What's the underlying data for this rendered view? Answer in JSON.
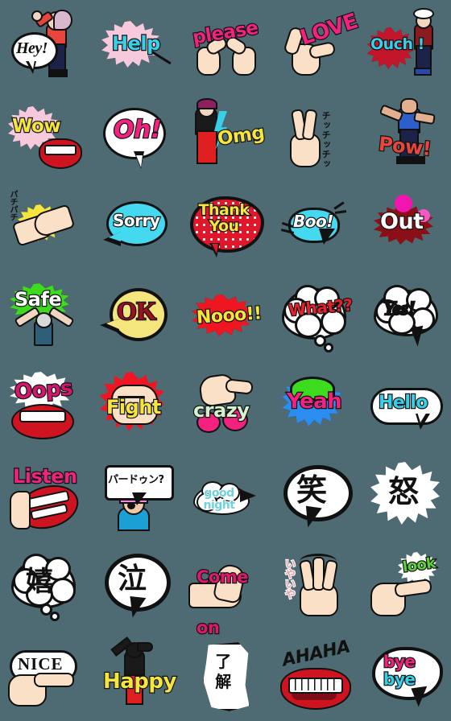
{
  "page": {
    "title": "Sticker Set Preview",
    "background_color": "#4e6b73",
    "columns": 5,
    "rows": 8,
    "cell_size_px": 112,
    "total_stickers": 40
  },
  "stickers": [
    {
      "id": 1,
      "text": "Hey!",
      "row": 1,
      "col": 1,
      "style": "speech-bubble-oval",
      "text_color": "#111111",
      "accent_color": "#e8453c",
      "art": "woman-waving-with-white-speech-bubble"
    },
    {
      "id": 2,
      "text": "Help",
      "row": 1,
      "col": 2,
      "style": "starburst",
      "text_color": "#38d0e8",
      "accent_color": "#f7c9dc",
      "art": "pink-starburst-with-pointer-line"
    },
    {
      "id": 3,
      "text": "please",
      "row": 1,
      "col": 3,
      "style": "hands-plain-text",
      "text_color": "#f3227f",
      "accent_color": "#fbe0c8",
      "art": "two-pointing-hands"
    },
    {
      "id": 4,
      "text": "LOVE",
      "row": 1,
      "col": 4,
      "style": "hand-plain-text",
      "text_color": "#f3227f",
      "accent_color": "#fbe0c8",
      "art": "finger-gun-hand-making-L"
    },
    {
      "id": 5,
      "text": "Ouch !",
      "row": 1,
      "col": 5,
      "style": "starburst",
      "text_color": "#38d0e8",
      "accent_color": "#c3162a",
      "art": "person-hit-with-red-burst"
    },
    {
      "id": 6,
      "text": "Wow",
      "row": 2,
      "col": 1,
      "style": "starburst",
      "text_color": "#f5e53c",
      "accent_color": "#f7c9dc",
      "art": "red-lips-with-pink-starburst"
    },
    {
      "id": 7,
      "text": "Oh!",
      "row": 2,
      "col": 2,
      "style": "speech-bubble-oval",
      "text_color": "#f3227f",
      "accent_color": "#ffffff",
      "art": "white-round-speech-bubble"
    },
    {
      "id": 8,
      "text": "Omg",
      "row": 2,
      "col": 3,
      "style": "lightning",
      "text_color": "#f5e53c",
      "accent_color": "#38d0e8",
      "art": "person-head-grab-with-lightning"
    },
    {
      "id": 9,
      "text": "チッチッチッ",
      "row": 2,
      "col": 4,
      "style": "hand-plain-text",
      "text_color": "#111111",
      "accent_color": "#fbe0c8",
      "art": "peace-sign-hand-with-kana"
    },
    {
      "id": 10,
      "text": "Pow!",
      "row": 2,
      "col": 5,
      "style": "person-plain-text",
      "text_color": "#e8453c",
      "accent_color": "#2b47a8",
      "art": "person-punching"
    },
    {
      "id": 11,
      "text": "パチパチ",
      "row": 3,
      "col": 1,
      "style": "hands-plain-text",
      "text_color": "#111111",
      "accent_color": "#f5e53c",
      "art": "clapping-hands-with-yellow-burst"
    },
    {
      "id": 12,
      "text": "Sorry",
      "row": 3,
      "col": 2,
      "style": "speech-bubble-oval",
      "text_color": "#ffffff",
      "accent_color": "#45d9f0",
      "art": "cyan-round-speech-bubble"
    },
    {
      "id": 13,
      "text": "Thank You",
      "row": 3,
      "col": 3,
      "style": "speech-bubble-polka",
      "text_color": "#f5e53c",
      "accent_color": "#e0162b",
      "art": "red-polka-dot-speech-bubble"
    },
    {
      "id": 14,
      "text": "Boo!",
      "row": 3,
      "col": 4,
      "style": "speech-bubble-oval",
      "text_color": "#ffffff",
      "accent_color": "#45d9f0",
      "art": "cyan-bubble-with-motion-lines"
    },
    {
      "id": 15,
      "text": "Out",
      "row": 3,
      "col": 5,
      "style": "splatter",
      "text_color": "#ffffff",
      "accent_color": "#f315b0",
      "art": "blood-splatter-with-magenta-blobs"
    },
    {
      "id": 16,
      "text": "Safe",
      "row": 4,
      "col": 1,
      "style": "starburst",
      "text_color": "#ffffff",
      "accent_color": "#3ddb1e",
      "art": "umpire-safe-arms-with-green-burst"
    },
    {
      "id": 17,
      "text": "OK",
      "row": 4,
      "col": 2,
      "style": "speech-bubble-oval",
      "text_color": "#9b1120",
      "accent_color": "#f5e57d",
      "art": "yellow-round-speech-bubble"
    },
    {
      "id": 18,
      "text": "Nooo!!",
      "row": 4,
      "col": 3,
      "style": "starburst",
      "text_color": "#f5e53c",
      "accent_color": "#ef1521",
      "art": "red-starburst"
    },
    {
      "id": 19,
      "text": "What??",
      "row": 4,
      "col": 4,
      "style": "thought-cloud",
      "text_color": "#e8202b",
      "accent_color": "#ffffff",
      "art": "white-thought-cloud"
    },
    {
      "id": 20,
      "text": "Yes!",
      "row": 4,
      "col": 5,
      "style": "thought-cloud",
      "text_color": "#111111",
      "accent_color": "#ffffff",
      "art": "white-cloud-bubble-with-tail"
    },
    {
      "id": 21,
      "text": "Oops",
      "row": 5,
      "col": 1,
      "style": "starburst",
      "text_color": "#d4166e",
      "accent_color": "#ffffff",
      "art": "red-lips-with-white-burst"
    },
    {
      "id": 22,
      "text": "Fight",
      "row": 5,
      "col": 2,
      "style": "flame",
      "text_color": "#f5e53c",
      "accent_color": "#ef1521",
      "art": "fist-with-red-flames"
    },
    {
      "id": 23,
      "text": "crazy",
      "row": 5,
      "col": 3,
      "style": "hand-plain-text",
      "text_color": "#b8e8b0",
      "accent_color": "#f3227f",
      "art": "hand-over-pink-blobs"
    },
    {
      "id": 24,
      "text": "Yeah",
      "row": 5,
      "col": 4,
      "style": "starburst",
      "text_color": "#f3227f",
      "accent_color": "#2b8df0",
      "art": "green-and-blue-burst"
    },
    {
      "id": 25,
      "text": "Hello",
      "row": 5,
      "col": 5,
      "style": "speech-bubble-rect",
      "text_color": "#38d0e8",
      "accent_color": "#ffffff",
      "art": "white-rounded-speech-bubble"
    },
    {
      "id": 26,
      "text": "Listen",
      "row": 6,
      "col": 1,
      "style": "lips-plain-text",
      "text_color": "#f3227f",
      "accent_color": "#b01020",
      "art": "hand-cupped-to-mouth"
    },
    {
      "id": 27,
      "text": "パードゥン?",
      "row": 6,
      "col": 2,
      "style": "speech-bubble-rect",
      "text_color": "#111111",
      "accent_color": "#ffffff",
      "art": "confused-person-with-rect-bubble"
    },
    {
      "id": 28,
      "text": "good night",
      "row": 6,
      "col": 3,
      "style": "thought-cloud",
      "text_color": "#6fd0e0",
      "accent_color": "#ffffff",
      "art": "small-white-cloud-bubble"
    },
    {
      "id": 29,
      "text": "笑",
      "row": 6,
      "col": 4,
      "style": "speech-bubble-oval",
      "text_color": "#111111",
      "accent_color": "#ffffff",
      "art": "white-bubble-with-kanji-warau"
    },
    {
      "id": 30,
      "text": "怒",
      "row": 6,
      "col": 5,
      "style": "starburst",
      "text_color": "#111111",
      "accent_color": "#ffffff",
      "art": "white-burst-with-kanji-ikari"
    },
    {
      "id": 31,
      "text": "嬉",
      "row": 7,
      "col": 1,
      "style": "thought-cloud",
      "text_color": "#111111",
      "accent_color": "#ffffff",
      "art": "white-thought-cloud-with-kanji-ureshii"
    },
    {
      "id": 32,
      "text": "泣",
      "row": 7,
      "col": 2,
      "style": "speech-bubble-oval",
      "text_color": "#111111",
      "accent_color": "#ffffff",
      "art": "white-round-bubble-with-kanji-naku"
    },
    {
      "id": 33,
      "text": "Come on",
      "row": 7,
      "col": 3,
      "style": "hand-plain-text",
      "text_color": "#e0176b",
      "accent_color": "#fbe0c8",
      "art": "beckoning-hands"
    },
    {
      "id": 34,
      "text": "いやいや",
      "row": 7,
      "col": 4,
      "style": "hand-plain-text",
      "text_color": "#e8a0a8",
      "accent_color": "#fbe0c8",
      "art": "waving-hand-refusing"
    },
    {
      "id": 35,
      "text": "look",
      "row": 7,
      "col": 5,
      "style": "starburst",
      "text_color": "#5bd13a",
      "accent_color": "#ffffff",
      "art": "pointing-hand-with-white-burst"
    },
    {
      "id": 36,
      "text": "NICE",
      "row": 8,
      "col": 1,
      "style": "speech-bubble-oval",
      "text_color": "#111111",
      "accent_color": "#ffffff",
      "art": "thumbs-up-hand-with-oval-bubble"
    },
    {
      "id": 37,
      "text": "Happy",
      "row": 8,
      "col": 2,
      "style": "person-plain-text",
      "text_color": "#f5e53c",
      "accent_color": "#ef1521",
      "art": "jumping-person-silhouette"
    },
    {
      "id": 38,
      "text": "了解",
      "row": 8,
      "col": 3,
      "style": "speech-bubble-rect",
      "text_color": "#111111",
      "accent_color": "#ffffff",
      "art": "torn-paper-bubble-with-kanji-ryoukai"
    },
    {
      "id": 39,
      "text": "AHAHA",
      "row": 8,
      "col": 4,
      "style": "lips-plain-text",
      "text_color": "#111111",
      "accent_color": "#cf1421",
      "art": "laughing-open-mouth-with-teeth"
    },
    {
      "id": 40,
      "text": "bye bye",
      "row": 8,
      "col": 5,
      "style": "speech-bubble-oval",
      "text_color": "#f3227f",
      "accent_color": "#38d0e8",
      "art": "white-bubble-with-bye-bye"
    }
  ]
}
